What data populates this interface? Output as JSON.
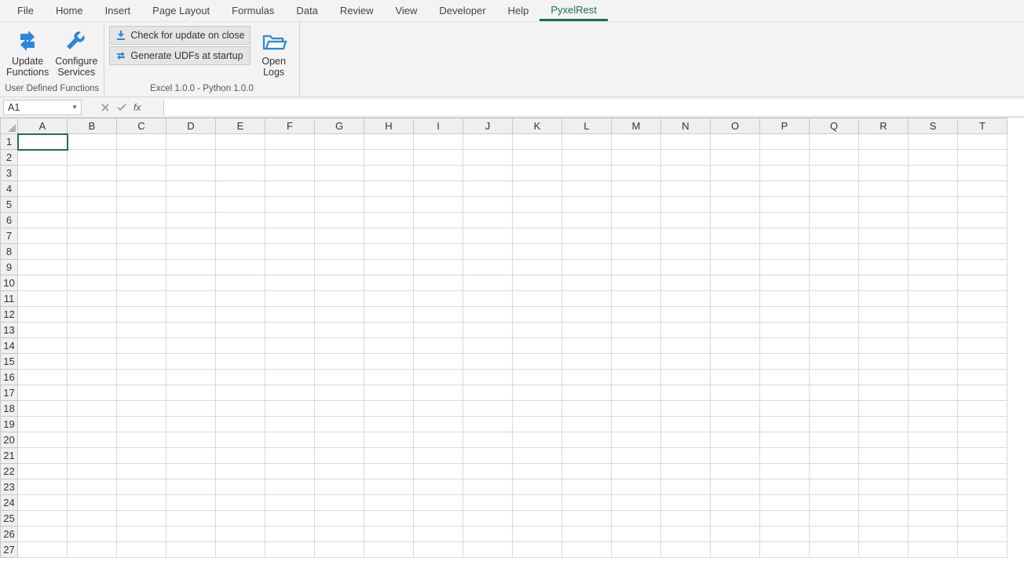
{
  "tabs": {
    "file": "File",
    "home": "Home",
    "insert": "Insert",
    "page_layout": "Page Layout",
    "formulas": "Formulas",
    "data": "Data",
    "review": "Review",
    "view": "View",
    "developer": "Developer",
    "help": "Help",
    "pyxelrest": "PyxelRest"
  },
  "ribbon": {
    "udf_group": {
      "update_functions_l1": "Update",
      "update_functions_l2": "Functions",
      "configure_services_l1": "Configure",
      "configure_services_l2": "Services",
      "label": "User Defined Functions"
    },
    "options_group": {
      "check_update": "Check for update on close",
      "generate_udfs": "Generate UDFs at startup",
      "open_logs_l1": "Open",
      "open_logs_l2": "Logs",
      "label": "Excel 1.0.0 - Python 1.0.0"
    }
  },
  "formula_bar": {
    "name_box": "A1",
    "input": ""
  },
  "grid": {
    "columns": [
      "A",
      "B",
      "C",
      "D",
      "E",
      "F",
      "G",
      "H",
      "I",
      "J",
      "K",
      "L",
      "M",
      "N",
      "O",
      "P",
      "Q",
      "R",
      "S",
      "T"
    ],
    "rows": [
      "1",
      "2",
      "3",
      "4",
      "5",
      "6",
      "7",
      "8",
      "9",
      "10",
      "11",
      "12",
      "13",
      "14",
      "15",
      "16",
      "17",
      "18",
      "19",
      "20",
      "21",
      "22",
      "23",
      "24",
      "25",
      "26",
      "27"
    ],
    "selected": "A1"
  }
}
